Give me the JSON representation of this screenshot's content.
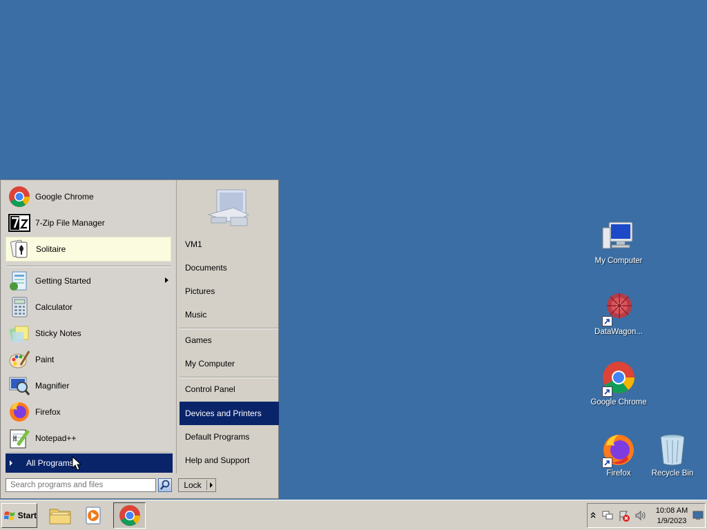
{
  "desktop": {
    "icons": [
      {
        "label": "My Computer",
        "icon": "computer-icon"
      },
      {
        "label": "DataWagon...",
        "icon": "datawagon-icon"
      },
      {
        "label": "Google Chrome",
        "icon": "chrome-icon"
      },
      {
        "label": "Firefox",
        "icon": "firefox-icon"
      },
      {
        "label": "Recycle Bin",
        "icon": "recycle-bin-icon"
      }
    ]
  },
  "start_menu": {
    "pinned": [
      {
        "label": "Google Chrome",
        "icon": "chrome-icon"
      },
      {
        "label": "7-Zip File Manager",
        "icon": "7zip-icon"
      },
      {
        "label": "Solitaire",
        "icon": "solitaire-icon"
      }
    ],
    "recent": [
      {
        "label": "Getting Started",
        "icon": "getting-started-icon",
        "has_submenu": true
      },
      {
        "label": "Calculator",
        "icon": "calculator-icon"
      },
      {
        "label": "Sticky Notes",
        "icon": "sticky-notes-icon"
      },
      {
        "label": "Paint",
        "icon": "paint-icon"
      },
      {
        "label": "Magnifier",
        "icon": "magnifier-icon"
      },
      {
        "label": "Firefox",
        "icon": "firefox-icon"
      },
      {
        "label": "Notepad++",
        "icon": "notepadpp-icon"
      }
    ],
    "all_programs": "All Programs",
    "search_placeholder": "Search programs and files",
    "right_items": [
      {
        "label": "VM1"
      },
      {
        "label": "Documents"
      },
      {
        "label": "Pictures"
      },
      {
        "label": "Music"
      },
      {
        "label": "Games"
      },
      {
        "label": "My Computer"
      },
      {
        "label": "Control Panel"
      },
      {
        "label": "Devices and Printers"
      },
      {
        "label": "Default Programs"
      },
      {
        "label": "Help and Support"
      }
    ],
    "lock_label": "Lock"
  },
  "taskbar": {
    "start_label": "Start",
    "clock_time": "10:08 AM",
    "clock_date": "1/9/2023"
  },
  "colors": {
    "desktop": "#3a6ea5",
    "highlight": "#0a246a",
    "menu_bg": "#d4d0c8"
  }
}
